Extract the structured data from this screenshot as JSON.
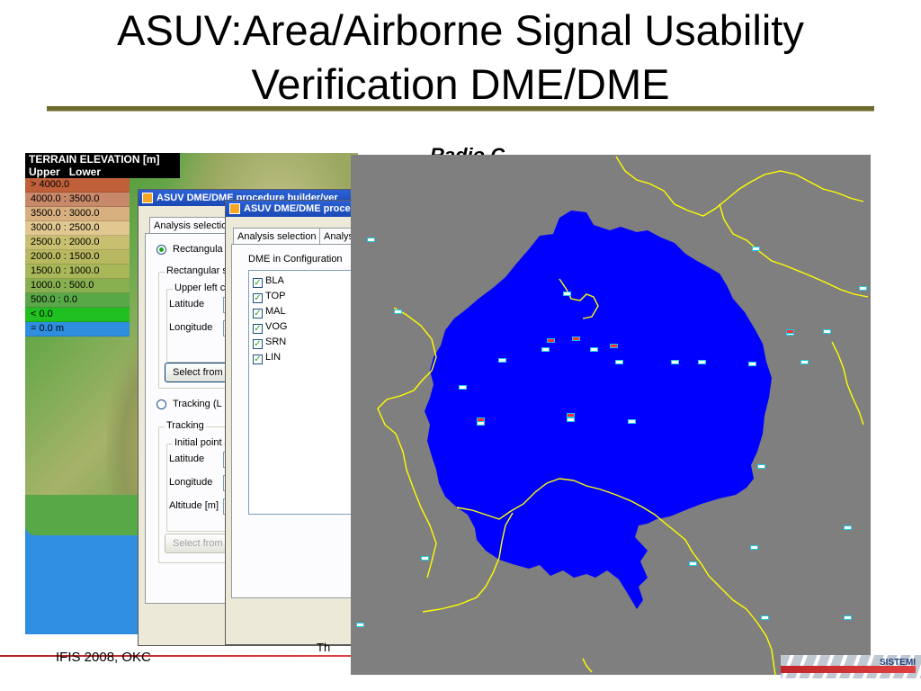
{
  "slide": {
    "title": "ASUV:Area/Airborne Signal Usability Verification DME/DME",
    "behind_text": "Radio C",
    "footer_left": "IFIS 2008, OKC",
    "footer_middle": "Th",
    "logo_text": "SISTEMI"
  },
  "terrain_legend": {
    "title": "TERRAIN ELEVATION [m]",
    "header_upper": "Upper",
    "header_lower": "Lower",
    "rows": [
      {
        "text": "> 4000.0",
        "color": "#c0603a"
      },
      {
        "text": "4000.0 : 3500.0",
        "color": "#c8886a"
      },
      {
        "text": "3500.0 : 3000.0",
        "color": "#d8b080"
      },
      {
        "text": "3000.0 : 2500.0",
        "color": "#e0c890"
      },
      {
        "text": "2500.0 : 2000.0",
        "color": "#c8c070"
      },
      {
        "text": "2000.0 : 1500.0",
        "color": "#b8b860"
      },
      {
        "text": "1500.0 : 1000.0",
        "color": "#a8b858"
      },
      {
        "text": "1000.0 : 500.0",
        "color": "#88b050"
      },
      {
        "text": "500.0 : 0.0",
        "color": "#58a848"
      },
      {
        "text": "< 0.0",
        "color": "#20c020"
      },
      {
        "text": "= 0.0 m",
        "color": "#2f8ee0"
      }
    ]
  },
  "window_back": {
    "title": "ASUV DME/DME procedure builder/ver",
    "tab": "Analysis selection",
    "radio_rect": "Rectangula",
    "group_rect": "Rectangular s",
    "subgroup_upper_left": "Upper left c",
    "latitude": "Latitude",
    "longitude": "Longitude",
    "select_btn": "Select from ",
    "radio_tracking": "Tracking (L",
    "group_tracking": "Tracking",
    "subgroup_initial": "Initial point",
    "latitude2": "Latitude",
    "longitude2": "Longitude",
    "altitude": "Altitude [m]",
    "select_btn2": "Select from "
  },
  "window_front": {
    "title": "ASUV DME/DME proce",
    "tab1": "Analysis selection",
    "tab2": "Analys",
    "list_label": "DME in Configuration",
    "dme_list": [
      "BLA",
      "TOP",
      "MAL",
      "VOG",
      "SRN",
      "LIN"
    ]
  },
  "coverage_map": {
    "background": "#7f7f7f",
    "coverage_color": "#0000ff",
    "border_color": "#ffff00",
    "marker_icon": "dme-station-icon"
  },
  "colors": {
    "title_rule": "#6b6b2e",
    "window_title_bar": "#2b62d6",
    "footer_red": "#c0262a"
  }
}
